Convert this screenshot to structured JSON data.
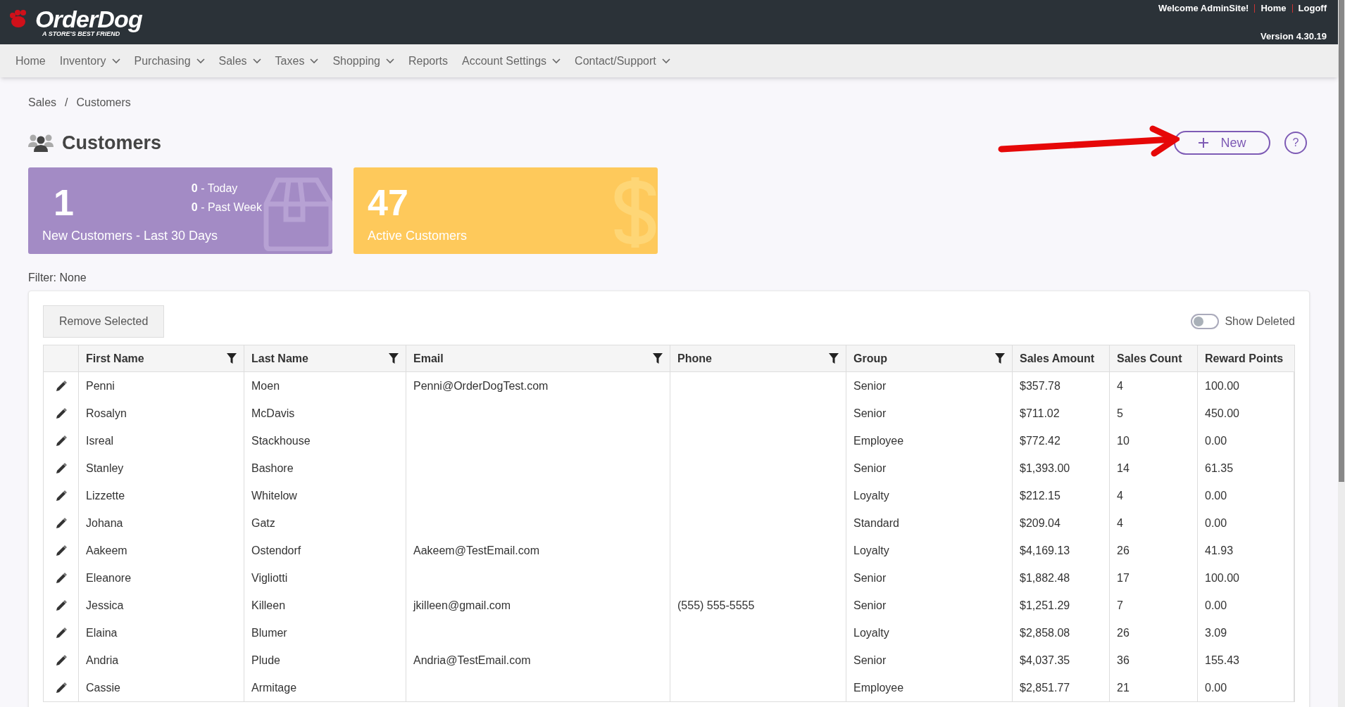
{
  "header": {
    "logo_text": "OrderDog",
    "logo_tagline": "A STORE'S BEST FRIEND",
    "welcome": "Welcome AdminSite!",
    "links": [
      "Home",
      "Logoff"
    ],
    "version": "Version 4.30.19"
  },
  "nav": [
    {
      "label": "Home",
      "dropdown": false
    },
    {
      "label": "Inventory",
      "dropdown": true
    },
    {
      "label": "Purchasing",
      "dropdown": true
    },
    {
      "label": "Sales",
      "dropdown": true
    },
    {
      "label": "Taxes",
      "dropdown": true
    },
    {
      "label": "Shopping",
      "dropdown": true
    },
    {
      "label": "Reports",
      "dropdown": false
    },
    {
      "label": "Account Settings",
      "dropdown": true
    },
    {
      "label": "Contact/Support",
      "dropdown": true
    }
  ],
  "breadcrumbs": [
    "Sales",
    "Customers"
  ],
  "breadcrumb_separator": "/",
  "title": "Customers",
  "new_button": "New",
  "help_button": "?",
  "cards": [
    {
      "kind": "new",
      "value": "1",
      "label": "New Customers - Last 30 Days",
      "stats": [
        {
          "count": "0",
          "label": " - Today"
        },
        {
          "count": "0",
          "label": " - Past Week"
        }
      ]
    },
    {
      "kind": "active",
      "value": "47",
      "label": "Active Customers"
    }
  ],
  "filter": "Filter: None",
  "remove_button": "Remove Selected",
  "show_deleted": {
    "label": "Show Deleted",
    "on": false
  },
  "table": {
    "columns": [
      {
        "label": "First Name",
        "filter": true
      },
      {
        "label": "Last Name",
        "filter": true
      },
      {
        "label": "Email",
        "filter": true
      },
      {
        "label": "Phone",
        "filter": true
      },
      {
        "label": "Group",
        "filter": true
      },
      {
        "label": "Sales Amount",
        "filter": false
      },
      {
        "label": "Sales Count",
        "filter": false
      },
      {
        "label": "Reward Points",
        "filter": false
      }
    ],
    "rows": [
      [
        "Penni",
        "Moen",
        "Penni@OrderDogTest.com",
        "",
        "Senior",
        "$357.78",
        "4",
        "100.00"
      ],
      [
        "Rosalyn",
        "McDavis",
        "",
        "",
        "Senior",
        "$711.02",
        "5",
        "450.00"
      ],
      [
        "Isreal",
        "Stackhouse",
        "",
        "",
        "Employee",
        "$772.42",
        "10",
        "0.00"
      ],
      [
        "Stanley",
        "Bashore",
        "",
        "",
        "Senior",
        "$1,393.00",
        "14",
        "61.35"
      ],
      [
        "Lizzette",
        "Whitelow",
        "",
        "",
        "Loyalty",
        "$212.15",
        "4",
        "0.00"
      ],
      [
        "Johana",
        "Gatz",
        "",
        "",
        "Standard",
        "$209.04",
        "4",
        "0.00"
      ],
      [
        "Aakeem",
        "Ostendorf",
        "Aakeem@TestEmail.com",
        "",
        "Loyalty",
        "$4,169.13",
        "26",
        "41.93"
      ],
      [
        "Eleanore",
        "Vigliotti",
        "",
        "",
        "Senior",
        "$1,882.48",
        "17",
        "100.00"
      ],
      [
        "Jessica",
        "Killeen",
        "jkilleen@gmail.com",
        "(555) 555-5555",
        "Senior",
        "$1,251.29",
        "7",
        "0.00"
      ],
      [
        "Elaina",
        "Blumer",
        "",
        "",
        "Loyalty",
        "$2,858.08",
        "26",
        "3.09"
      ],
      [
        "Andria",
        "Plude",
        "Andria@TestEmail.com",
        "",
        "Senior",
        "$4,037.35",
        "36",
        "155.43"
      ],
      [
        "Cassie",
        "Armitage",
        "",
        "",
        "Employee",
        "$2,851.77",
        "21",
        "0.00"
      ]
    ]
  }
}
